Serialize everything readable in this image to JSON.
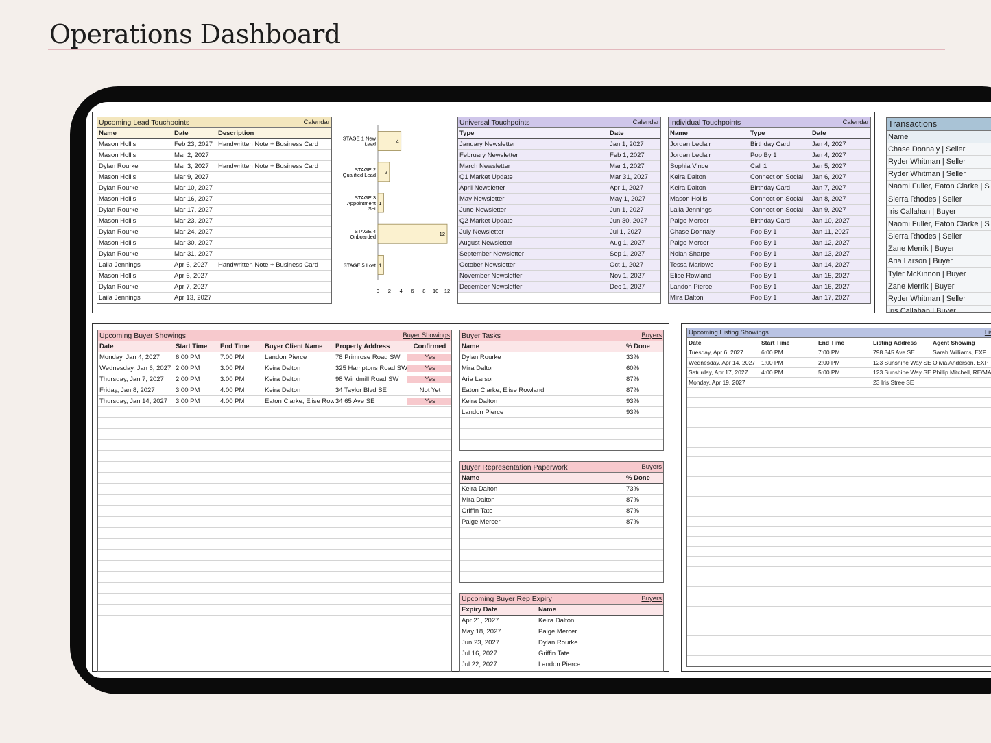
{
  "page": {
    "title": "Operations Dashboard"
  },
  "lead_touchpoints": {
    "title": "Upcoming Lead Touchpoints",
    "link": "Calendar",
    "columns": [
      "Name",
      "Date",
      "Description"
    ],
    "rows": [
      [
        "Mason Hollis",
        "Feb 23, 2027",
        "Handwritten Note + Business Card"
      ],
      [
        "Mason Hollis",
        "Mar 2, 2027",
        ""
      ],
      [
        "Dylan Rourke",
        "Mar 3, 2027",
        "Handwritten Note + Business Card"
      ],
      [
        "Mason Hollis",
        "Mar 9, 2027",
        ""
      ],
      [
        "Dylan Rourke",
        "Mar 10, 2027",
        ""
      ],
      [
        "Mason Hollis",
        "Mar 16, 2027",
        ""
      ],
      [
        "Dylan Rourke",
        "Mar 17, 2027",
        ""
      ],
      [
        "Mason Hollis",
        "Mar 23, 2027",
        ""
      ],
      [
        "Dylan Rourke",
        "Mar 24, 2027",
        ""
      ],
      [
        "Mason Hollis",
        "Mar 30, 2027",
        ""
      ],
      [
        "Dylan Rourke",
        "Mar 31, 2027",
        ""
      ],
      [
        "Laila Jennings",
        "Apr 6, 2027",
        "Handwritten Note + Business Card"
      ],
      [
        "Mason Hollis",
        "Apr 6, 2027",
        ""
      ],
      [
        "Dylan Rourke",
        "Apr 7, 2027",
        ""
      ],
      [
        "Laila Jennings",
        "Apr 13, 2027",
        ""
      ]
    ]
  },
  "chart_data": {
    "type": "bar",
    "orientation": "horizontal",
    "categories": [
      "STAGE 1 New Lead",
      "STAGE 2 Qualified Lead",
      "STAGE 3 Appointment Set",
      "STAGE 4 Onboarded",
      "STAGE 5 Lost"
    ],
    "category_lines": [
      [
        "STAGE 1 New",
        "Lead"
      ],
      [
        "STAGE 2",
        "Qualified Lead"
      ],
      [
        "STAGE 3",
        "Appointment",
        "Set"
      ],
      [
        "STAGE 4",
        "Onboarded"
      ],
      [
        "STAGE 5 Lost"
      ]
    ],
    "values": [
      4,
      2,
      1,
      12,
      1
    ],
    "xlim": [
      0,
      12
    ],
    "xticks": [
      "0",
      "2",
      "4",
      "6",
      "8",
      "10",
      "12"
    ],
    "bar_color": "#fbf1cf",
    "bar_stroke": "#9a8a55"
  },
  "universal_touchpoints": {
    "title": "Universal Touchpoints",
    "link": "Calendar",
    "columns": [
      "Type",
      "Date"
    ],
    "rows": [
      [
        "January Newsletter",
        "Jan 1, 2027"
      ],
      [
        "February Newsletter",
        "Feb 1, 2027"
      ],
      [
        "March Newsletter",
        "Mar 1, 2027"
      ],
      [
        "Q1 Market Update",
        "Mar 31, 2027"
      ],
      [
        "April Newsletter",
        "Apr 1, 2027"
      ],
      [
        "May Newsletter",
        "May 1, 2027"
      ],
      [
        "June Newsletter",
        "Jun 1, 2027"
      ],
      [
        "Q2 Market Update",
        "Jun 30, 2027"
      ],
      [
        "July Newsletter",
        "Jul 1, 2027"
      ],
      [
        "August Newsletter",
        "Aug 1, 2027"
      ],
      [
        "September Newsletter",
        "Sep 1, 2027"
      ],
      [
        "October Newsletter",
        "Oct 1, 2027"
      ],
      [
        "November Newsletter",
        "Nov 1, 2027"
      ],
      [
        "December Newsletter",
        "Dec 1, 2027"
      ]
    ]
  },
  "individual_touchpoints": {
    "title": "Individual Touchpoints",
    "link": "Calendar",
    "columns": [
      "Name",
      "Type",
      "Date"
    ],
    "rows": [
      [
        "Jordan Leclair",
        "Birthday Card",
        "Jan 4, 2027"
      ],
      [
        "Jordan Leclair",
        "Pop By 1",
        "Jan 4, 2027"
      ],
      [
        "Sophia Vince",
        "Call 1",
        "Jan 5, 2027"
      ],
      [
        "Keira Dalton",
        "Connect on Social",
        "Jan 6, 2027"
      ],
      [
        "Keira Dalton",
        "Birthday Card",
        "Jan 7, 2027"
      ],
      [
        "Mason Hollis",
        "Connect on Social",
        "Jan 8, 2027"
      ],
      [
        "Laila Jennings",
        "Connect on Social",
        "Jan 9, 2027"
      ],
      [
        "Paige Mercer",
        "Birthday Card",
        "Jan 10, 2027"
      ],
      [
        "Chase Donnaly",
        "Pop By 1",
        "Jan 11, 2027"
      ],
      [
        "Paige Mercer",
        "Pop By 1",
        "Jan 12, 2027"
      ],
      [
        "Nolan Sharpe",
        "Pop By 1",
        "Jan 13, 2027"
      ],
      [
        "Tessa Marlowe",
        "Pop By 1",
        "Jan 14, 2027"
      ],
      [
        "Elise Rowland",
        "Pop By 1",
        "Jan 15, 2027"
      ],
      [
        "Landon Pierce",
        "Pop By 1",
        "Jan 16, 2027"
      ],
      [
        "Mira Dalton",
        "Pop By 1",
        "Jan 17, 2027"
      ]
    ]
  },
  "transactions": {
    "title": "Transactions",
    "column": "Name",
    "rows": [
      "Chase Donnaly | Seller",
      "Ryder Whitman | Seller",
      "Ryder Whitman | Seller",
      "Naomi Fuller, Eaton Clarke | S",
      "Sierra Rhodes | Seller",
      "Iris Callahan | Buyer",
      "Naomi Fuller, Eaton Clarke | S",
      "Sierra Rhodes | Seller",
      "Zane Merrik | Buyer",
      "Aria Larson | Buyer",
      "Tyler McKinnon | Buyer",
      "Zane Merrik | Buyer",
      "Ryder Whitman | Seller",
      "Iris Callahan | Buyer"
    ]
  },
  "buyer_showings": {
    "title": "Upcoming Buyer Showings",
    "link": "Buyer Showings",
    "columns": [
      "Date",
      "Start Time",
      "End Time",
      "Buyer Client Name",
      "Property Address",
      "Confirmed"
    ],
    "rows": [
      [
        "Monday, Jan 4, 2027",
        "6:00 PM",
        "7:00 PM",
        "Landon Pierce",
        "78 Primrose Road SW",
        "Yes"
      ],
      [
        "Wednesday, Jan 6, 2027",
        "2:00 PM",
        "3:00 PM",
        "Keira Dalton",
        "325 Hamptons Road SW",
        "Yes"
      ],
      [
        "Thursday, Jan 7, 2027",
        "2:00 PM",
        "3:00 PM",
        "Keira Dalton",
        "98 Windmill Road SW",
        "Yes"
      ],
      [
        "Friday, Jan 8, 2027",
        "3:00 PM",
        "4:00 PM",
        "Keira Dalton",
        "34 Taylor Blvd SE",
        "Not Yet"
      ],
      [
        "Thursday, Jan 14, 2027",
        "3:00 PM",
        "4:00 PM",
        "Eaton Clarke, Elise Rowland",
        "34 65 Ave SE",
        "Yes"
      ]
    ]
  },
  "buyer_tasks": {
    "title": "Buyer Tasks",
    "link": "Buyers",
    "columns": [
      "Name",
      "% Done"
    ],
    "rows": [
      [
        "Dylan Rourke",
        "33%"
      ],
      [
        "Mira Dalton",
        "60%"
      ],
      [
        "Aria Larson",
        "87%"
      ],
      [
        "Eaton Clarke, Elise Rowland",
        "87%"
      ],
      [
        "Keira Dalton",
        "93%"
      ],
      [
        "Landon Pierce",
        "93%"
      ]
    ]
  },
  "buyer_rep_paperwork": {
    "title": "Buyer Representation Paperwork",
    "link": "Buyers",
    "columns": [
      "Name",
      "% Done"
    ],
    "rows": [
      [
        "Keira Dalton",
        "73%"
      ],
      [
        "Mira Dalton",
        "87%"
      ],
      [
        "Griffin Tate",
        "87%"
      ],
      [
        "Paige Mercer",
        "87%"
      ]
    ]
  },
  "buyer_rep_expiry": {
    "title": "Upcoming Buyer Rep Expiry",
    "link": "Buyers",
    "columns": [
      "Expiry Date",
      "Name"
    ],
    "rows": [
      [
        "Apr 21, 2027",
        "Keira Dalton"
      ],
      [
        "May 18, 2027",
        "Paige Mercer"
      ],
      [
        "Jun 23, 2027",
        "Dylan Rourke"
      ],
      [
        "Jul 16, 2027",
        "Griffin Tate"
      ],
      [
        "Jul 22, 2027",
        "Landon Pierce"
      ]
    ]
  },
  "listing_showings": {
    "title": "Upcoming Listing Showings",
    "link": "Lis",
    "columns": [
      "Date",
      "Start Time",
      "End Time",
      "Listing Address",
      "Agent Showing"
    ],
    "rows": [
      [
        "Tuesday, Apr 6, 2027",
        "6:00 PM",
        "7:00 PM",
        "798 345 Ave SE",
        "Sarah Williams, EXP"
      ],
      [
        "Wednesday, Apr 14, 2027",
        "1:00 PM",
        "2:00 PM",
        "123 Sunshine Way SE",
        "Olivia Anderson, EXP"
      ],
      [
        "Saturday, Apr 17, 2027",
        "4:00 PM",
        "5:00 PM",
        "123 Sunshine Way SE",
        "Phillip Mitchell, RE/MAX"
      ],
      [
        "Monday, Apr 19, 2027",
        "",
        "",
        "23 Iris Stree SE",
        ""
      ]
    ]
  },
  "colors": {
    "background": "#f4efeb",
    "bezel": "#0b0b0b",
    "yellow_header": "#f3e6bd",
    "purple_header": "#cfc6ea",
    "pink_header": "#f7c9cd",
    "blue_header": "#a9c3d6",
    "lavender_blue_header": "#b9c3e3"
  }
}
